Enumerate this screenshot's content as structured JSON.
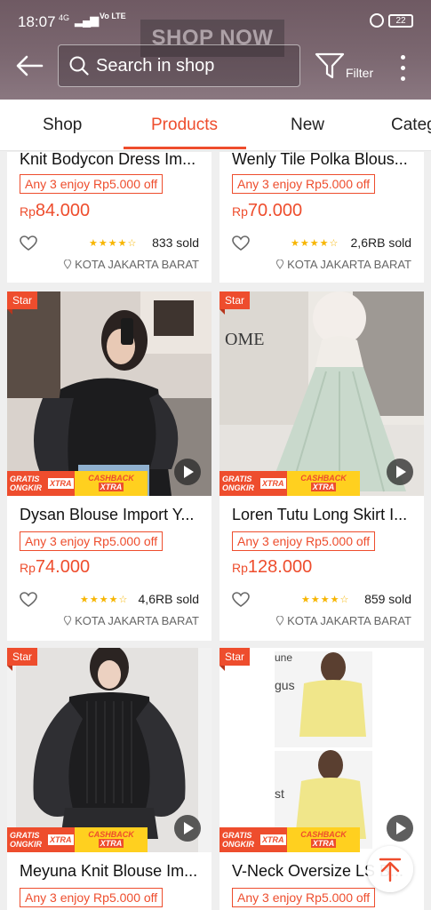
{
  "status_bar": {
    "time": "18:07",
    "network": "4G",
    "carrier_tag": "Vo LTE",
    "battery": "22"
  },
  "header": {
    "banner_text": "SHOP NOW",
    "search_placeholder": "Search in shop",
    "filter_label": "Filter",
    "back_icon": "arrow-left-icon",
    "filter_icon": "funnel-icon",
    "more_icon": "vertical-dots-icon"
  },
  "tabs": [
    {
      "label": "Shop",
      "active": false
    },
    {
      "label": "Products",
      "active": true
    },
    {
      "label": "New",
      "active": false
    },
    {
      "label": "Categ",
      "active": false
    }
  ],
  "colors": {
    "accent": "#ee4d2d",
    "star": "#f7b500",
    "cashback": "#ffd01f"
  },
  "products": [
    {
      "name": "Knit Bodycon Dress Im...",
      "promo": "Any 3 enjoy Rp5.000 off",
      "currency": "Rp",
      "price": "84.000",
      "rating": 4.5,
      "sold": "833 sold",
      "location": "KOTA JAKARTA BARAT"
    },
    {
      "name": "Wenly Tile Polka Blous...",
      "promo": "Any 3 enjoy Rp5.000 off",
      "currency": "Rp",
      "price": "70.000",
      "rating": 4.5,
      "sold": "2,6RB sold",
      "location": "KOTA JAKARTA BARAT"
    },
    {
      "name": "Dysan Blouse Import Y...",
      "promo": "Any 3 enjoy Rp5.000 off",
      "currency": "Rp",
      "price": "74.000",
      "rating": 4.5,
      "sold": "4,6RB sold",
      "location": "KOTA JAKARTA BARAT",
      "badge": "Star",
      "shipping_label": "GRATIS ONGKIR",
      "shipping_tag": "XTRA",
      "cashback_label": "CASHBACK",
      "cashback_tag": "XTRA"
    },
    {
      "name": "Loren Tutu Long Skirt I...",
      "promo": "Any 3 enjoy Rp5.000 off",
      "currency": "Rp",
      "price": "128.000",
      "rating": 4.5,
      "sold": "859 sold",
      "location": "KOTA JAKARTA BARAT",
      "badge": "Star",
      "shipping_label": "GRATIS ONGKIR",
      "shipping_tag": "XTRA",
      "cashback_label": "CASHBACK",
      "cashback_tag": "XTRA"
    },
    {
      "name": "Meyuna Knit Blouse Im...",
      "promo": "Any 3 enjoy Rp5.000 off",
      "badge": "Star",
      "shipping_label": "GRATIS ONGKIR",
      "shipping_tag": "XTRA",
      "cashback_label": "CASHBACK",
      "cashback_tag": "XTRA"
    },
    {
      "name": "V-Neck Oversize LS B...",
      "promo": "Any 3 enjoy Rp5.000 off",
      "badge": "Star",
      "shipping_label": "GRATIS ONGKIR",
      "shipping_tag": "XTRA",
      "cashback_label": "CASHBACK",
      "cashback_tag": "XTRA",
      "image_text": [
        "une",
        "gus",
        "st"
      ]
    }
  ]
}
